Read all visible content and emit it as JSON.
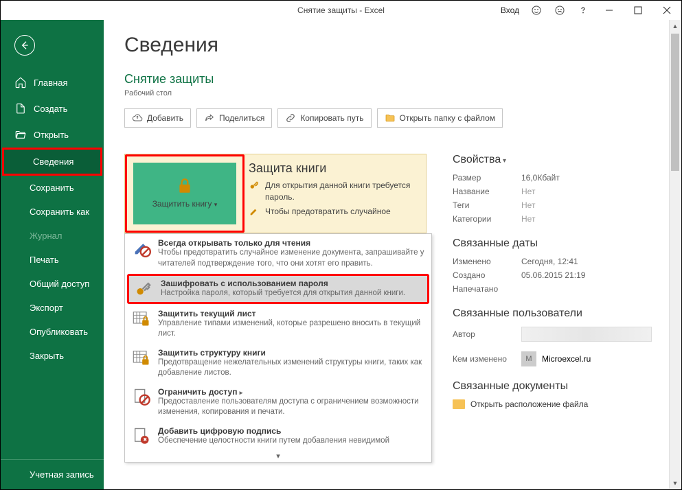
{
  "titlebar": {
    "title": "Снятие защиты  -  Excel",
    "login": "Вход"
  },
  "sidebar": {
    "home": "Главная",
    "new": "Создать",
    "open": "Открыть",
    "info": "Сведения",
    "save": "Сохранить",
    "saveas": "Сохранить как",
    "history": "Журнал",
    "print": "Печать",
    "share": "Общий доступ",
    "export": "Экспорт",
    "publish": "Опубликовать",
    "close": "Закрыть",
    "account": "Учетная запись"
  },
  "main": {
    "page_title": "Сведения",
    "doc_title": "Снятие защиты",
    "doc_path": "Рабочий стол",
    "actions": {
      "upload": "Добавить",
      "share": "Поделиться",
      "copy_path": "Копировать путь",
      "open_folder": "Открыть папку с файлом"
    },
    "protect": {
      "button": "Защитить книгу",
      "title": "Защита книги",
      "line1": "Для открытия данной книги требуется пароль.",
      "line2": "Чтобы предотвратить случайное"
    },
    "menu": {
      "readonly_t": "Всегда открывать только для чтения",
      "readonly_d": "Чтобы предотвратить случайное изменение документа, запрашивайте у читателей подтверждение того, что они хотят его править.",
      "encrypt_t": "Зашифровать с использованием пароля",
      "encrypt_d": "Настройка пароля, который требуется для открытия данной книги.",
      "sheet_t": "Защитить текущий лист",
      "sheet_d": "Управление типами изменений, которые разрешено вносить в текущий лист.",
      "struct_t": "Защитить структуру книги",
      "struct_d": "Предотвращение нежелательных изменений структуры книги, таких как добавление листов.",
      "restrict_t": "Ограничить доступ",
      "restrict_d": "Предоставление пользователям доступа с ограничением возможности изменения, копирования и печати.",
      "sign_t": "Добавить цифровую подпись",
      "sign_d": "Обеспечение целостности книги путем добавления невидимой"
    },
    "props": {
      "heading": "Свойства",
      "size_l": "Размер",
      "size_v": "16,0Кбайт",
      "title_l": "Название",
      "title_v": "Нет",
      "tags_l": "Теги",
      "tags_v": "Нет",
      "cat_l": "Категории",
      "cat_v": "Нет",
      "dates_heading": "Связанные даты",
      "modified_l": "Изменено",
      "modified_v": "Сегодня, 12:41",
      "created_l": "Создано",
      "created_v": "05.06.2015 21:19",
      "printed_l": "Напечатано",
      "users_heading": "Связанные пользователи",
      "author_l": "Автор",
      "changed_l": "Кем изменено",
      "changed_initial": "M",
      "changed_v": "Microexcel.ru",
      "docs_heading": "Связанные документы",
      "open_loc": "Открыть расположение файла"
    }
  }
}
